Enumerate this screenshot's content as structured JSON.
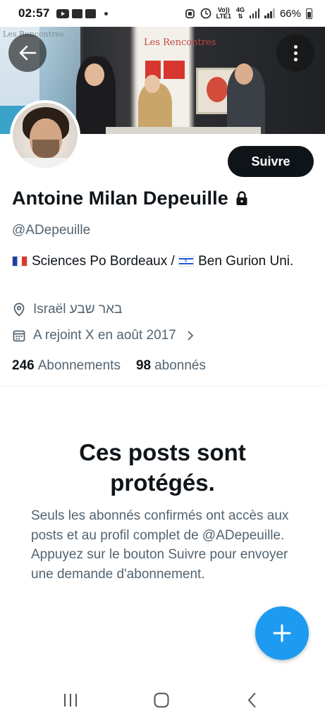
{
  "status_bar": {
    "time": "02:57",
    "network_line1": "Vo))",
    "network_line2": "LTE1",
    "data_type": "4G",
    "battery": "66%",
    "icons": [
      "youtube-icon",
      "app-icon",
      "app-icon",
      "notification-dot",
      "alarm-icon",
      "clock-icon",
      "signal-icon",
      "battery-icon"
    ]
  },
  "banner": {
    "sign_left": "Les Rencontres",
    "sign_mid": "Les Rencontres",
    "back_icon": "arrow-left-icon",
    "more_icon": "more-vertical-icon"
  },
  "profile": {
    "follow_label": "Suivre",
    "name": "Antoine Milan Depeuille",
    "protected_icon": "lock-icon",
    "handle": "@ADepeuille",
    "bio_part1": "Sciences Po Bordeaux / ",
    "bio_part2": "Ben Gurion Uni.",
    "location": "Israël באר שבע",
    "joined": "A rejoint X en août 2017",
    "following_count": "246",
    "following_label": "Abonnements",
    "followers_count": "98",
    "followers_label": "abonnés"
  },
  "protected_notice": {
    "title": "Ces posts sont protégés.",
    "description": "Seuls les abonnés confirmés ont accès aux posts et au profil complet de @ADepeuille. Appuyez sur le bouton Suivre pour envoyer une demande d'abonnement."
  },
  "fab": {
    "icon": "plus-icon"
  },
  "nav_bar": {
    "icons": [
      "recents-icon",
      "home-icon",
      "back-icon"
    ]
  },
  "colors": {
    "accent": "#1d9bf0",
    "text": "#0f1419",
    "secondary": "#536471"
  }
}
